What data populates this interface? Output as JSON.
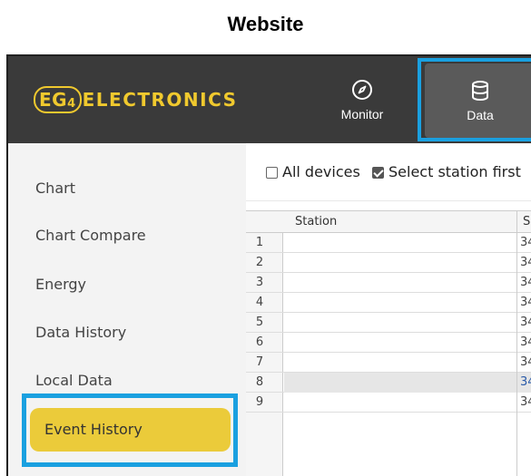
{
  "caption": "Website",
  "header": {
    "logo_eg": "EG",
    "logo_sub": "4",
    "logo_text": "ELECTRONICS",
    "nav": [
      {
        "label": "Monitor",
        "icon": "compass-icon"
      },
      {
        "label": "Data",
        "icon": "database-icon",
        "active": true
      }
    ]
  },
  "sidebar": {
    "items": [
      {
        "label": "Chart"
      },
      {
        "label": "Chart Compare"
      },
      {
        "label": "Energy"
      },
      {
        "label": "Data History"
      },
      {
        "label": "Local Data"
      },
      {
        "label": "Event History",
        "active": true
      }
    ]
  },
  "filters": {
    "all_devices": {
      "label": "All devices",
      "checked": false
    },
    "select_station_first": {
      "label": "Select station first",
      "checked": true
    }
  },
  "table": {
    "columns": [
      "Station",
      "Se"
    ],
    "rows": [
      {
        "num": "1",
        "station": "",
        "sn": "34"
      },
      {
        "num": "2",
        "station": "",
        "sn": "34"
      },
      {
        "num": "3",
        "station": "",
        "sn": "34"
      },
      {
        "num": "4",
        "station": "",
        "sn": "34"
      },
      {
        "num": "5",
        "station": "",
        "sn": "34"
      },
      {
        "num": "6",
        "station": "",
        "sn": "34"
      },
      {
        "num": "7",
        "station": "",
        "sn": "34"
      },
      {
        "num": "8",
        "station": "",
        "sn": "34",
        "selected": true
      },
      {
        "num": "9",
        "station": "",
        "sn": "34"
      }
    ]
  },
  "colors": {
    "brand_yellow": "#f0c92e",
    "highlight_blue": "#1aa0e0",
    "header_bg": "#3a3a3a",
    "active_item": "#ebcb3a"
  }
}
